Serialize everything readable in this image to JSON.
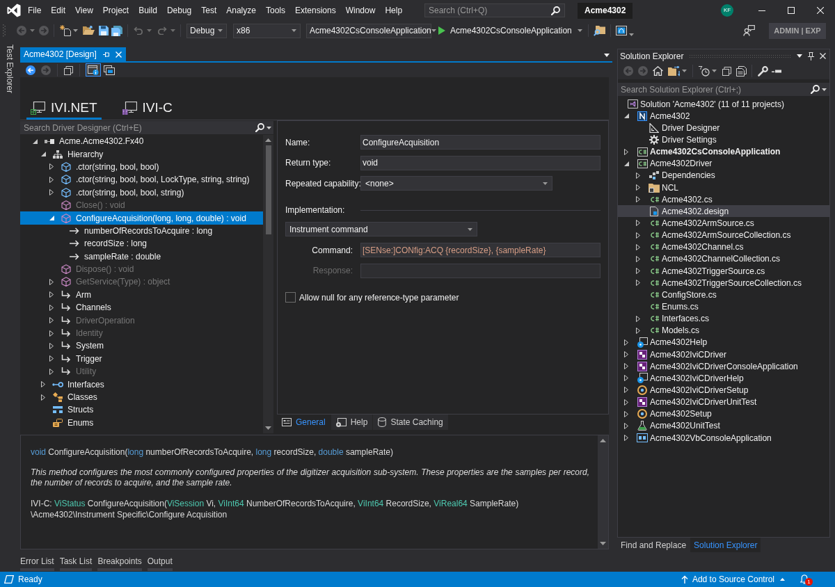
{
  "menu": [
    "File",
    "Edit",
    "View",
    "Project",
    "Build",
    "Debug",
    "Test",
    "Analyze",
    "Tools",
    "Extensions",
    "Window",
    "Help"
  ],
  "search": {
    "placeholder": "Search (Ctrl+Q)"
  },
  "solution_badge": "Acme4302",
  "account": {
    "initials": "KF"
  },
  "toolbar": {
    "configuration": "Debug",
    "platform": "x86",
    "startup_project": "Acme4302CsConsoleApplication",
    "run_target": "Acme4302CsConsoleApplication"
  },
  "mode_badge": "ADMIN | EXP",
  "side_tabs": [
    "Test Explorer"
  ],
  "document": {
    "tab_title": "Acme4302 [Design]",
    "view_toggles": [
      {
        "kind": "details",
        "pressed": true
      },
      {
        "kind": "windows",
        "pressed": false
      }
    ],
    "designer_tabs": [
      {
        "label": "IVI.NET",
        "kind": "net",
        "selected": true
      },
      {
        "label": "IVI-C",
        "kind": "c",
        "selected": false
      }
    ],
    "tree_search": {
      "placeholder": "Search Driver Designer (Ctrl+E)"
    },
    "tree": [
      {
        "label": "Acme.Acme4302.Fx40",
        "kind": "namespace",
        "expanded": true,
        "selected": false,
        "disabled": false,
        "children": [
          {
            "label": "Hierarchy",
            "kind": "hierarchy",
            "expanded": true,
            "selected": false,
            "disabled": false,
            "children": [
              {
                "label": ".ctor(string, bool, bool)",
                "kind": "constructor",
                "expanded": false,
                "selected": false,
                "disabled": false
              },
              {
                "label": ".ctor(string, bool, bool, LockType, string, string)",
                "kind": "constructor",
                "expanded": false,
                "selected": false,
                "disabled": false
              },
              {
                "label": ".ctor(string, bool, bool, string)",
                "kind": "constructor",
                "expanded": false,
                "selected": false,
                "disabled": false
              },
              {
                "label": "Close() : void",
                "kind": "method",
                "selected": false,
                "disabled": true
              },
              {
                "label": "ConfigureAcquisition(long, long, double) : void",
                "kind": "method",
                "expanded": true,
                "selected": true,
                "disabled": false,
                "children": [
                  {
                    "label": "numberOfRecordsToAcquire : long",
                    "kind": "parameter",
                    "selected": false,
                    "disabled": false
                  },
                  {
                    "label": "recordSize : long",
                    "kind": "parameter",
                    "selected": false,
                    "disabled": false
                  },
                  {
                    "label": "sampleRate : double",
                    "kind": "parameter",
                    "selected": false,
                    "disabled": false
                  }
                ]
              },
              {
                "label": "Dispose() : void",
                "kind": "method",
                "selected": false,
                "disabled": true
              },
              {
                "label": "GetService(Type) : object",
                "kind": "method",
                "expanded": false,
                "selected": false,
                "disabled": true
              },
              {
                "label": "Arm",
                "kind": "reference",
                "expanded": false,
                "selected": false,
                "disabled": false
              },
              {
                "label": "Channels",
                "kind": "reference",
                "expanded": false,
                "selected": false,
                "disabled": false
              },
              {
                "label": "DriverOperation",
                "kind": "reference",
                "expanded": false,
                "selected": false,
                "disabled": true
              },
              {
                "label": "Identity",
                "kind": "reference",
                "expanded": false,
                "selected": false,
                "disabled": true
              },
              {
                "label": "System",
                "kind": "reference",
                "expanded": false,
                "selected": false,
                "disabled": false
              },
              {
                "label": "Trigger",
                "kind": "reference",
                "expanded": false,
                "selected": false,
                "disabled": false
              },
              {
                "label": "Utility",
                "kind": "reference",
                "expanded": false,
                "selected": false,
                "disabled": true
              }
            ]
          },
          {
            "label": "Interfaces",
            "kind": "interfaces",
            "expanded": false,
            "selected": false,
            "disabled": false
          },
          {
            "label": "Classes",
            "kind": "classes",
            "expanded": false,
            "selected": false,
            "disabled": false
          },
          {
            "label": "Structs",
            "kind": "structs",
            "selected": false,
            "disabled": false
          },
          {
            "label": "Enums",
            "kind": "enums",
            "selected": false,
            "disabled": false
          }
        ]
      }
    ],
    "properties": {
      "fields": [
        {
          "label": "Name:",
          "value": "ConfigureAcquisition",
          "kind": "text"
        },
        {
          "label": "Return type:",
          "value": "void",
          "kind": "text"
        },
        {
          "label": "Repeated capability:",
          "value": "<none>",
          "kind": "dropdown"
        }
      ],
      "implementation": {
        "label": "Implementation:",
        "mode": "Instrument command",
        "fields": [
          {
            "label": "Command:",
            "value": "[SENse:]CONfig:ACQ {recordSize}, {sampleRate}",
            "disabled": false
          },
          {
            "label": "Response:",
            "disabled": true
          }
        ]
      },
      "allow_null": {
        "label": "Allow null for any reference-type parameter",
        "checked": false
      },
      "tabs": [
        {
          "label": "General",
          "kind": "general",
          "selected": true
        },
        {
          "label": "Help",
          "kind": "help",
          "selected": false
        },
        {
          "label": "State Caching",
          "kind": "state",
          "selected": false
        }
      ]
    },
    "description": {
      "signature": [
        {
          "text": "void",
          "kind": "keyword"
        },
        {
          "text": " ConfigureAcquisition(",
          "kind": "text"
        },
        {
          "text": "long",
          "kind": "keyword"
        },
        {
          "text": " numberOfRecordsToAcquire, ",
          "kind": "text"
        },
        {
          "text": "long",
          "kind": "keyword"
        },
        {
          "text": " recordSize, ",
          "kind": "text"
        },
        {
          "text": "double",
          "kind": "keyword"
        },
        {
          "text": " sampleRate)",
          "kind": "text"
        }
      ],
      "summary": "This method configures the most commonly configured properties of the digitizer acquisition sub-system. These properties are the samples per record, the number of records to acquire, and the sample rate.",
      "ivi_c": [
        {
          "text": "IVI-C: ",
          "kind": "text"
        },
        {
          "text": "ViStatus",
          "kind": "type"
        },
        {
          "text": " ConfigureAcquisition(",
          "kind": "text"
        },
        {
          "text": "ViSession",
          "kind": "type"
        },
        {
          "text": " Vi, ",
          "kind": "text"
        },
        {
          "text": "ViInt64",
          "kind": "type"
        },
        {
          "text": " NumberOfRecordsToAcquire, ",
          "kind": "text"
        },
        {
          "text": "ViInt64",
          "kind": "type"
        },
        {
          "text": " RecordSize, ",
          "kind": "text"
        },
        {
          "text": "ViReal64",
          "kind": "type"
        },
        {
          "text": " SampleRate)",
          "kind": "text"
        }
      ],
      "path": "\\Acme4302\\Instrument Specific\\Configure Acquisition"
    }
  },
  "tool_tabs": [
    "Error List",
    "Task List",
    "Breakpoints",
    "Output"
  ],
  "solution_explorer": {
    "title": "Solution Explorer",
    "search": {
      "placeholder": "Search Solution Explorer (Ctrl+;)"
    },
    "tree": [
      {
        "label": "Solution 'Acme4302' (11 of 11 projects)",
        "kind": "solution",
        "selected": false,
        "children": [
          {
            "label": "Acme4302",
            "kind": "ivi-project",
            "expanded": true,
            "selected": false,
            "startup": false,
            "children": [
              {
                "label": "Driver Designer",
                "kind": "designer",
                "selected": false
              },
              {
                "label": "Driver Settings",
                "kind": "settings",
                "selected": false
              }
            ]
          },
          {
            "label": "Acme4302CsConsoleApplication",
            "kind": "cs-project",
            "expanded": false,
            "selected": false,
            "startup": true
          },
          {
            "label": "Acme4302Driver",
            "kind": "cs-project",
            "expanded": true,
            "selected": false,
            "startup": false,
            "children": [
              {
                "label": "Dependencies",
                "kind": "dependencies",
                "expanded": false,
                "selected": false
              },
              {
                "label": "NCL",
                "kind": "folder",
                "expanded": false,
                "selected": false
              },
              {
                "label": "Acme4302.cs",
                "kind": "cs-file",
                "expanded": false,
                "selected": false
              },
              {
                "label": "Acme4302.design",
                "kind": "design-file",
                "selected": true
              },
              {
                "label": "Acme4302ArmSource.cs",
                "kind": "cs-file",
                "expanded": false,
                "selected": false
              },
              {
                "label": "Acme4302ArmSourceCollection.cs",
                "kind": "cs-file",
                "expanded": false,
                "selected": false
              },
              {
                "label": "Acme4302Channel.cs",
                "kind": "cs-file",
                "expanded": false,
                "selected": false
              },
              {
                "label": "Acme4302ChannelCollection.cs",
                "kind": "cs-file",
                "expanded": false,
                "selected": false
              },
              {
                "label": "Acme4302TriggerSource.cs",
                "kind": "cs-file",
                "expanded": false,
                "selected": false
              },
              {
                "label": "Acme4302TriggerSourceCollection.cs",
                "kind": "cs-file",
                "expanded": false,
                "selected": false
              },
              {
                "label": "ConfigStore.cs",
                "kind": "cs-file",
                "selected": false
              },
              {
                "label": "Enums.cs",
                "kind": "cs-file",
                "selected": false
              },
              {
                "label": "Interfaces.cs",
                "kind": "cs-file",
                "expanded": false,
                "selected": false
              },
              {
                "label": "Models.cs",
                "kind": "cs-file",
                "expanded": false,
                "selected": false
              }
            ]
          },
          {
            "label": "Acme4302Help",
            "kind": "help-project",
            "expanded": false,
            "selected": false,
            "startup": false
          },
          {
            "label": "Acme4302IviCDriver",
            "kind": "ivic-project",
            "expanded": false,
            "selected": false,
            "startup": false
          },
          {
            "label": "Acme4302IviCDriverConsoleApplication",
            "kind": "ivic-project",
            "expanded": false,
            "selected": false,
            "startup": false
          },
          {
            "label": "Acme4302IviCDriverHelp",
            "kind": "help-project",
            "expanded": false,
            "selected": false,
            "startup": false
          },
          {
            "label": "Acme4302IviCDriverSetup",
            "kind": "setup-project",
            "expanded": false,
            "selected": false,
            "startup": false
          },
          {
            "label": "Acme4302IviCDriverUnitTest",
            "kind": "ivic-project",
            "expanded": false,
            "selected": false,
            "startup": false
          },
          {
            "label": "Acme4302Setup",
            "kind": "setup-project",
            "expanded": false,
            "selected": false,
            "startup": false
          },
          {
            "label": "Acme4302UnitTest",
            "kind": "test-project",
            "expanded": false,
            "selected": false,
            "startup": false
          },
          {
            "label": "Acme4302VbConsoleApplication",
            "kind": "vb-project",
            "expanded": false,
            "selected": false,
            "startup": false
          }
        ]
      }
    ],
    "tabs": [
      {
        "label": "Find and Replace",
        "selected": false
      },
      {
        "label": "Solution Explorer",
        "selected": true
      }
    ]
  },
  "status_bar": {
    "text": "Ready",
    "source_control": "Add to Source Control",
    "notifications": "1"
  }
}
